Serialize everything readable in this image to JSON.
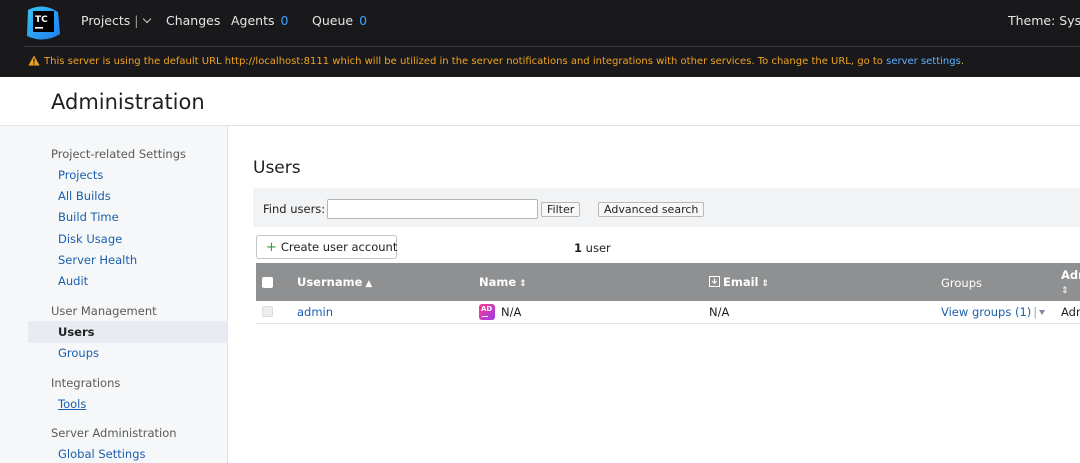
{
  "header": {
    "logo_text": "TC",
    "nav": {
      "projects": "Projects",
      "changes": "Changes",
      "agents": "Agents",
      "agents_count": "0",
      "queue": "Queue",
      "queue_count": "0"
    },
    "theme": "Theme: System"
  },
  "warning": {
    "text": "This server is using the default URL http://localhost:8111 which will be utilized in the server notifications and integrations with other services. To change the URL, go to",
    "link": "server settings",
    "tail": "."
  },
  "page": {
    "title": "Administration"
  },
  "sidebar": {
    "groups": [
      {
        "label": "Project-related Settings",
        "items": [
          "Projects",
          "All Builds",
          "Build Time",
          "Disk Usage",
          "Server Health",
          "Audit"
        ]
      },
      {
        "label": "User Management",
        "items": [
          "Users",
          "Groups"
        ]
      },
      {
        "label": "Integrations",
        "items": [
          "Tools"
        ]
      },
      {
        "label": "Server Administration",
        "items": [
          "Global Settings"
        ]
      }
    ],
    "active_item": "Users"
  },
  "main": {
    "title": "Users",
    "find_label": "Find users:",
    "find_value": "",
    "filter_button": "Filter",
    "advanced_button": "Advanced search",
    "create_button": "Create user account",
    "count_number": "1",
    "count_label": "user",
    "table": {
      "columns": {
        "username": "Username",
        "name": "Name",
        "email": "Email",
        "groups": "Groups",
        "admin": "Adm"
      },
      "rows": [
        {
          "username": "admin",
          "avatar": "AD",
          "name": "N/A",
          "email": "N/A",
          "groups": "View groups (1)",
          "admin": "Adm"
        }
      ]
    }
  },
  "colors": {
    "header_bg": "#19191c",
    "warning": "#f0a31f",
    "link": "#1a5fae",
    "table_header_bg": "#8f9091"
  }
}
